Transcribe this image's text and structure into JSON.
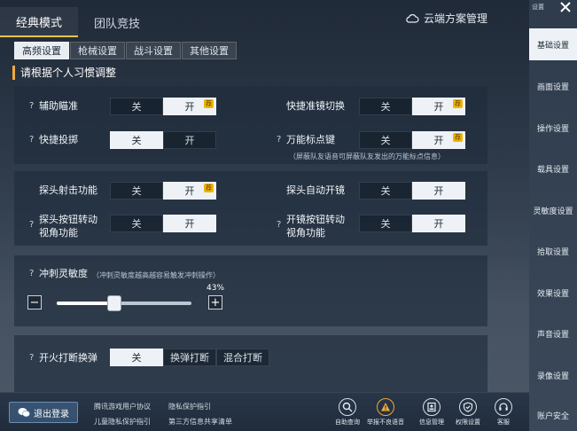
{
  "top_tabs": [
    {
      "label": "经典模式",
      "active": true
    },
    {
      "label": "团队竞技",
      "active": false
    }
  ],
  "cloud_button": {
    "label": "云端方案管理",
    "icon": "cloud-icon"
  },
  "sub_tabs": [
    {
      "label": "高频设置",
      "active": true
    },
    {
      "label": "枪械设置",
      "active": false
    },
    {
      "label": "战斗设置",
      "active": false
    },
    {
      "label": "其他设置",
      "active": false
    }
  ],
  "section_title": "请根据个人习惯调整",
  "toggle_options": {
    "off": "关",
    "on": "开"
  },
  "badge_text": "荐",
  "help_mark": "?",
  "panel1": {
    "aim_assist": {
      "label": "辅助瞄准",
      "value": "开"
    },
    "quick_scope_switch": {
      "label": "快捷准镜切换",
      "value": "开"
    },
    "quick_throw": {
      "label": "快捷投掷",
      "value": "关"
    },
    "universal_marker": {
      "label": "万能标点键",
      "value": "开"
    },
    "note": "（屏蔽队友语音可屏蔽队友发出的万能标点信息）"
  },
  "panel2": {
    "peek_fire": {
      "label": "探头射击功能",
      "value": "开"
    },
    "peek_auto_scope": {
      "label": "探头自动开镜",
      "value": "开"
    },
    "peek_button_turn": {
      "label_line1": "探头按钮转动",
      "label_line2": "视角功能",
      "value": "开"
    },
    "scope_button_turn": {
      "label_line1": "开镜按钮转动",
      "label_line2": "视角功能",
      "value": "开"
    }
  },
  "panel3": {
    "sprint_sensitivity": {
      "label": "冲刺灵敏度",
      "note": "（冲刺灵敏度越高越容易触发冲刺操作）",
      "value_percent": 43,
      "value_text": "43%"
    },
    "minus": "−",
    "plus": "+"
  },
  "panel4": {
    "fire_interrupt_reload": {
      "label": "开火打断换弹",
      "options": [
        "关",
        "换弹打断",
        "混合打断"
      ],
      "selected": "关"
    }
  },
  "bottom_bar": {
    "logout_label": "退出登录",
    "links": [
      "腾讯游戏用户协议",
      "隐私保护指引",
      "儿童隐私保护指引",
      "第三方信息共享清单"
    ],
    "icon_buttons": [
      {
        "label": "自助查询",
        "icon": "search-icon"
      },
      {
        "label": "举报不良语音",
        "icon": "warning-icon"
      },
      {
        "label": "信息管理",
        "icon": "id-card-icon"
      },
      {
        "label": "权限设置",
        "icon": "shield-icon"
      },
      {
        "label": "客服",
        "icon": "headset-icon"
      }
    ]
  },
  "sidebar": {
    "close_hint": "设置",
    "items": [
      {
        "label": "基础设置",
        "active": true
      },
      {
        "label": "画面设置",
        "active": false
      },
      {
        "label": "操作设置",
        "active": false
      },
      {
        "label": "载具设置",
        "active": false
      },
      {
        "label": "灵敏度设置",
        "active": false
      },
      {
        "label": "拾取设置",
        "active": false
      },
      {
        "label": "效果设置",
        "active": false
      },
      {
        "label": "声音设置",
        "active": false
      },
      {
        "label": "录像设置",
        "active": false
      },
      {
        "label": "账户安全",
        "active": false
      }
    ]
  },
  "colors": {
    "accent": "#f0c14b",
    "badge": "#f0b400",
    "active_bg": "#eef2f6"
  }
}
